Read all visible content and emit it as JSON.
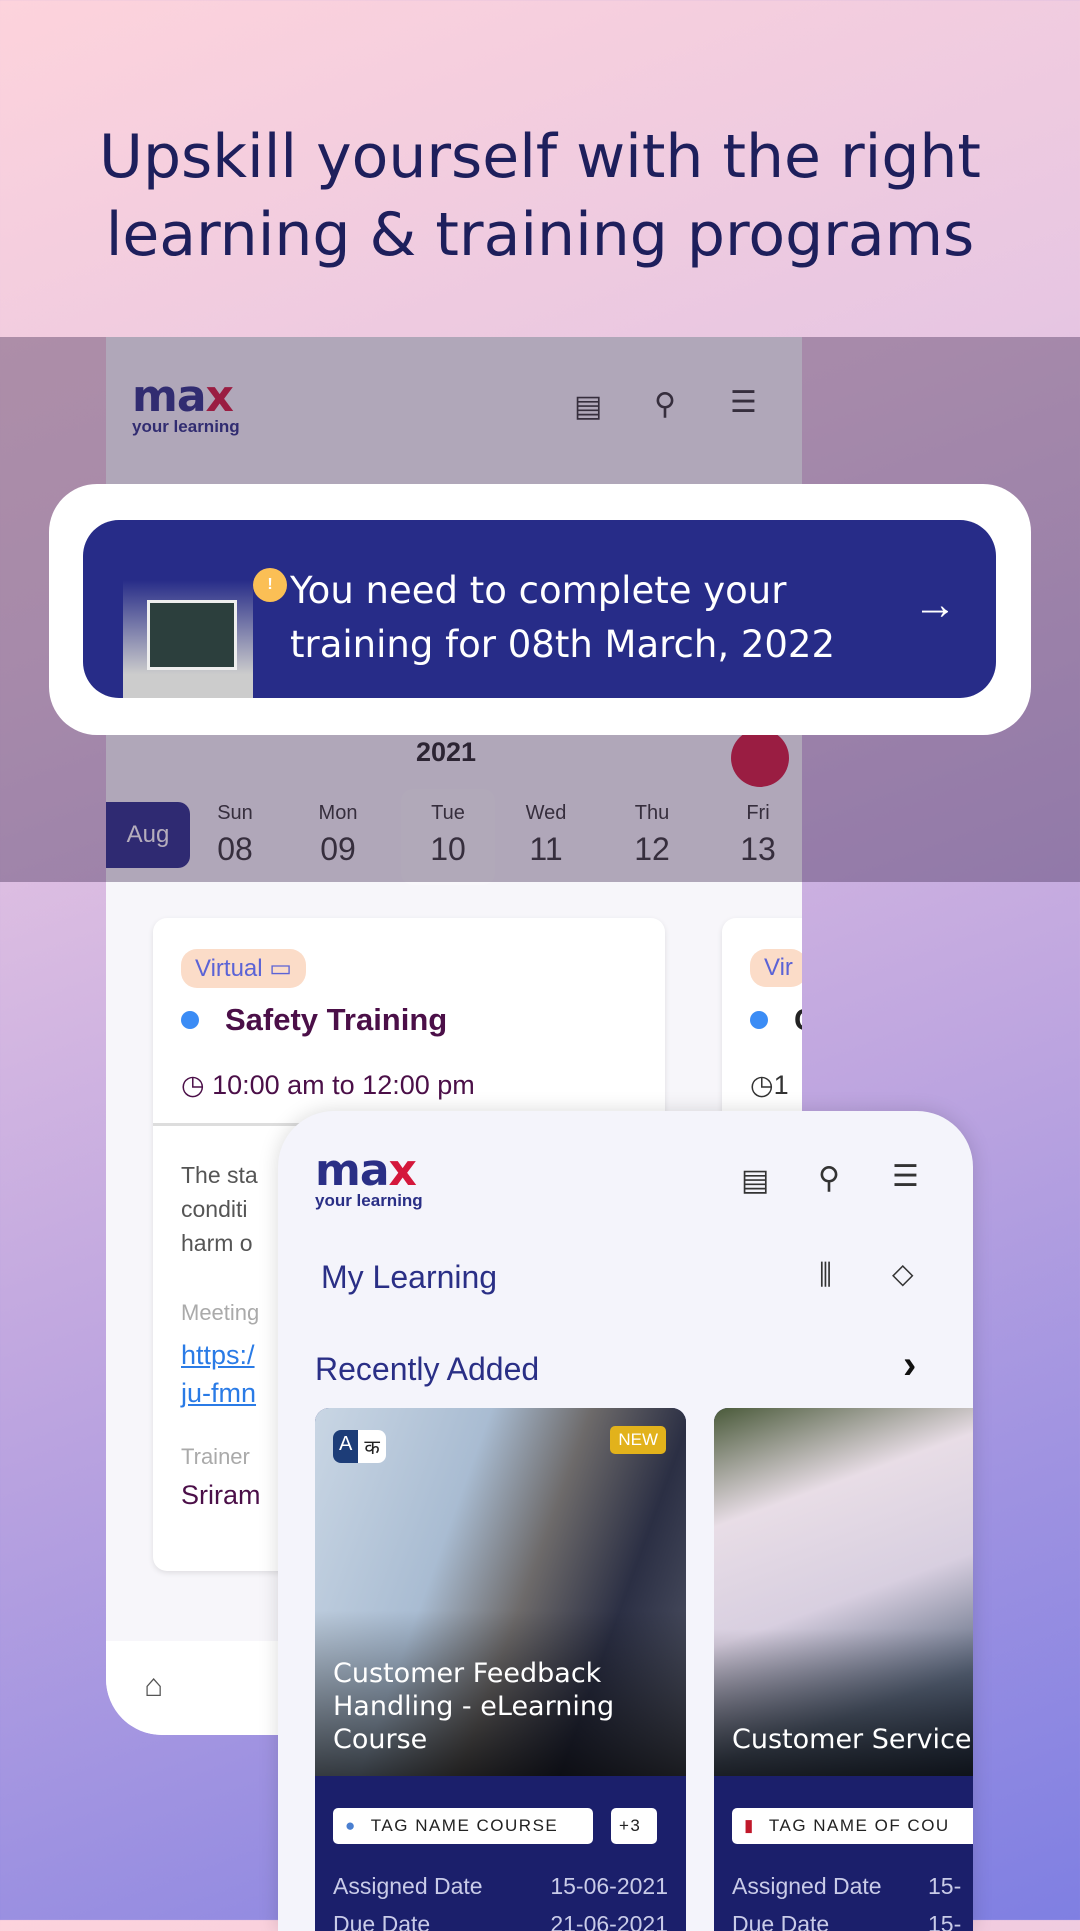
{
  "headline": [
    "Upskill yourself with the right",
    "learning & training programs"
  ],
  "logo": {
    "main": "ma",
    "accent": "x",
    "sub": "your learning"
  },
  "header_icons": [
    "news-icon",
    "search-icon",
    "menu-icon"
  ],
  "banner": {
    "text_line1": "You need to complete your",
    "text_line2": "training for 08th March, 2022",
    "arrow": "→"
  },
  "calendar": {
    "year": "2021",
    "month": "Aug",
    "days": [
      {
        "name": "Sun",
        "date": "08"
      },
      {
        "name": "Mon",
        "date": "09"
      },
      {
        "name": "Tue",
        "date": "10",
        "selected": true
      },
      {
        "name": "Wed",
        "date": "11"
      },
      {
        "name": "Thu",
        "date": "12"
      },
      {
        "name": "Fri",
        "date": "13"
      }
    ]
  },
  "session": {
    "mode": "Virtual",
    "title": "Safety Training",
    "time": "10:00 am to 12:00 pm",
    "desc": [
      "The sta",
      "conditi",
      "harm o"
    ],
    "meeting_label": "Meeting",
    "link": [
      "https:/",
      "ju-fmn"
    ],
    "trainer_label": "Trainer",
    "trainer": "Sriram",
    "second_mode": "Vir",
    "second_title": "C",
    "second_time": "1"
  },
  "my_learning": {
    "title": "My Learning",
    "recent": "Recently Added",
    "chevron": "›"
  },
  "courses": [
    {
      "title": "Customer Feedback Handling - eLearning Course",
      "badge": "NEW",
      "lang": [
        "A",
        "क"
      ],
      "tag": "TAG NAME COURSE",
      "more": "+3",
      "assigned_label": "Assigned Date",
      "assigned": "15-06-2021",
      "due_label": "Due Date",
      "due": "21-06-2021"
    },
    {
      "title": "Customer Service",
      "tag": "TAG NAME OF COU",
      "assigned_label": "Assigned Date",
      "assigned": "15-",
      "due_label": "Due Date",
      "due": "15-"
    }
  ],
  "colors": {
    "brand": "#2a2f86",
    "accent": "#d4173b",
    "banner": "#272c88",
    "card_bottom": "#1b1f6b"
  }
}
